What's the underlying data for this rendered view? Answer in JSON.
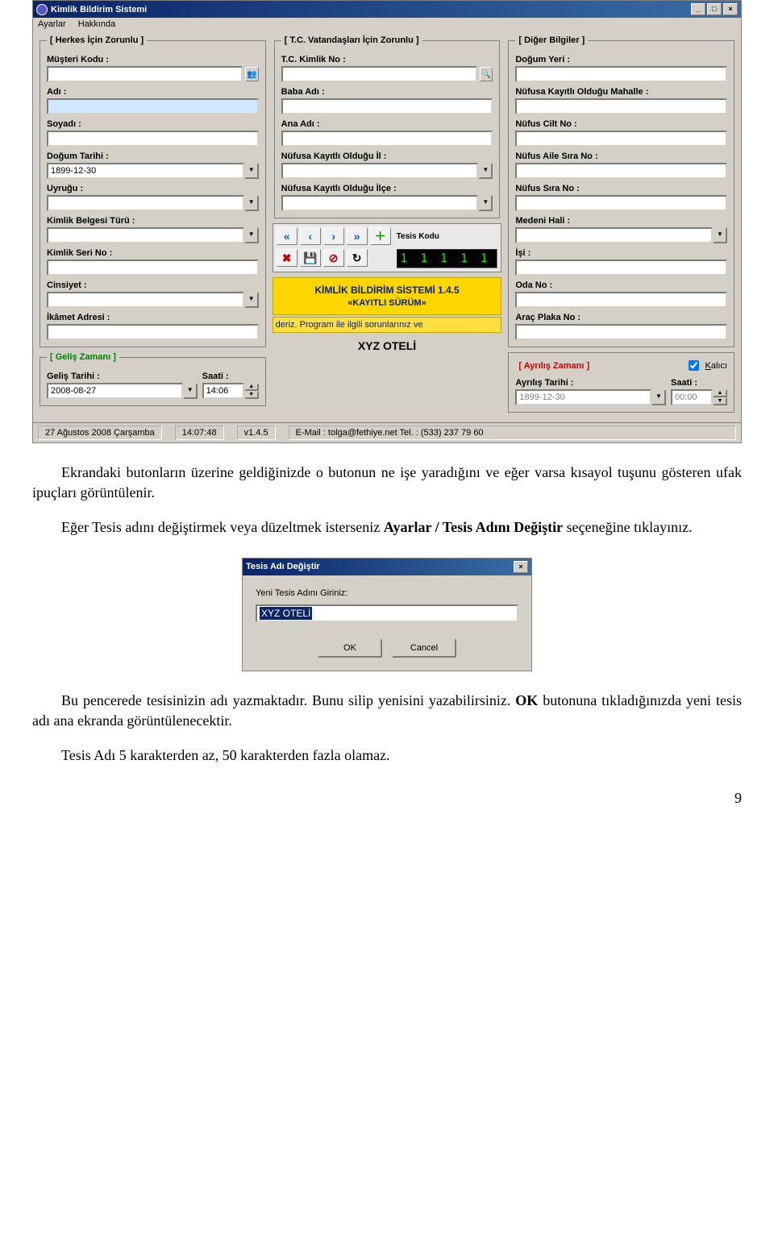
{
  "window": {
    "title": "Kimlik Bildirim Sistemi",
    "menu": {
      "ayarlar": "Ayarlar",
      "hakkinda": "Hakkında"
    }
  },
  "groups": {
    "herkes": "[ Herkes İçin Zorunlu ]",
    "tc": "[ T.C. Vatandaşları İçin Zorunlu ]",
    "diger": "[ Diğer Bilgiler ]",
    "gelis": "[ Geliş Zamanı ]",
    "ayrilis": "[ Ayrılış Zamanı ]"
  },
  "labels": {
    "musteri_kodu": "Müşteri Kodu :",
    "adi": "Adı :",
    "soyadi": "Soyadı :",
    "dogum_tarihi": "Doğum Tarihi :",
    "uyrugu": "Uyruğu :",
    "kimlik_belge_turu": "Kimlik Belgesi Türü :",
    "kimlik_seri_no": "Kimlik Seri No :",
    "cinsiyet": "Cinsiyet :",
    "ikamet": "İkâmet Adresi :",
    "tc_kimlik_no": "T.C. Kimlik No :",
    "baba_adi": "Baba Adı :",
    "ana_adi": "Ana Adı :",
    "nufusa_kayitli_il": "Nüfusa Kayıtlı Olduğu İl :",
    "nufusa_kayitli_ilce": "Nüfusa Kayıtlı Olduğu İlçe :",
    "dogum_yeri": "Doğum Yeri :",
    "nufusa_kayitli_mahalle": "Nüfusa Kayıtlı Olduğu Mahalle :",
    "nufus_cilt_no": "Nüfus Cilt No :",
    "nufus_aile_sira_no": "Nüfus Aile Sıra No :",
    "nufus_sira_no": "Nüfus Sıra No :",
    "medeni_hali": "Medeni Hali :",
    "isi": "İşi :",
    "oda_no": "Oda No :",
    "arac_plaka_no": "Araç Plaka No :",
    "tesis_kodu": "Tesis Kodu",
    "gelis_tarihi": "Geliş Tarihi :",
    "saati": "Saati :",
    "ayrilis_tarihi": "Ayrılış Tarihi :",
    "kalici": "Kalıcı"
  },
  "values": {
    "dogum_tarihi": "1899-12-30",
    "gelis_tarihi": "2008-08-27",
    "gelis_saati": "14:06",
    "ayrilis_tarihi": "1899-12-30",
    "ayrilis_saati": "00:00",
    "tesis_kodu_digits": "1 1 1 1 1"
  },
  "banner": {
    "line1": "KİMLİK BİLDİRİM SİSTEMİ 1.4.5",
    "line2": "«KAYITLI SÜRÜM»",
    "scroll": "deriz. Program ile ilgili sorunlarınız ve"
  },
  "hotel_name": "XYZ OTELİ",
  "status": {
    "date": "27 Ağustos 2008 Çarşamba",
    "time": "14:07:48",
    "version": "v1.4.5",
    "contact": "E-Mail : tolga@fethiye.net   Tel. : (533) 237 79 60"
  },
  "doc": {
    "p1": "Ekrandaki butonların üzerine geldiğinizde o butonun ne işe yaradığını ve eğer varsa kısayol tuşunu gösteren ufak ipuçları görüntülenir.",
    "p2a": "Eğer Tesis adını değiştirmek veya düzeltmek isterseniz ",
    "p2b": "Ayarlar / Tesis Adını Değiştir",
    "p2c": " seçeneğine tıklayınız.",
    "p3a": "Bu pencerede tesisinizin adı yazmaktadır. Bunu silip yenisini yazabilirsiniz. ",
    "p3b": "OK",
    "p3c": " butonuna tıkladığınızda yeni tesis adı ana ekranda görüntülenecektir.",
    "p4": "Tesis Adı 5 karakterden az, 50 karakterden fazla olamaz.",
    "page_num": "9"
  },
  "dialog": {
    "title": "Tesis Adı Değiştir",
    "label": "Yeni Tesis Adını Giriniz:",
    "value": "XYZ OTELİ",
    "ok": "OK",
    "cancel": "Cancel"
  }
}
